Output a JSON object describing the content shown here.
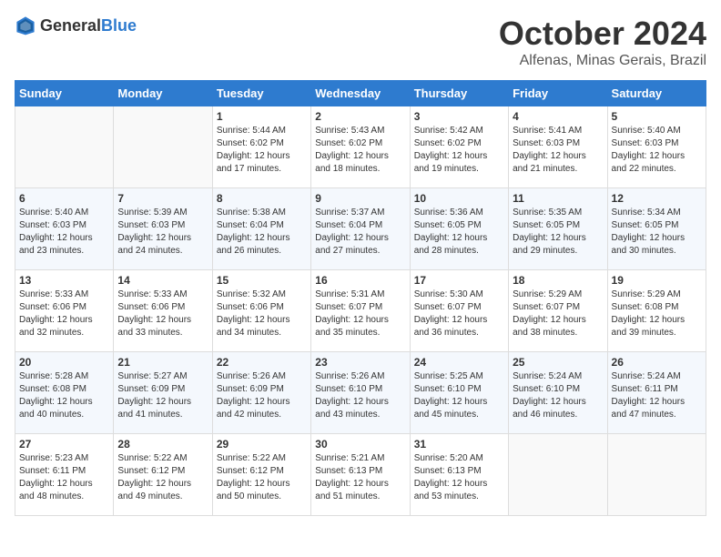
{
  "header": {
    "logo_general": "General",
    "logo_blue": "Blue",
    "month": "October 2024",
    "location": "Alfenas, Minas Gerais, Brazil"
  },
  "weekdays": [
    "Sunday",
    "Monday",
    "Tuesday",
    "Wednesday",
    "Thursday",
    "Friday",
    "Saturday"
  ],
  "weeks": [
    [
      {
        "day": "",
        "sunrise": "",
        "sunset": "",
        "daylight": ""
      },
      {
        "day": "",
        "sunrise": "",
        "sunset": "",
        "daylight": ""
      },
      {
        "day": "1",
        "sunrise": "Sunrise: 5:44 AM",
        "sunset": "Sunset: 6:02 PM",
        "daylight": "Daylight: 12 hours and 17 minutes."
      },
      {
        "day": "2",
        "sunrise": "Sunrise: 5:43 AM",
        "sunset": "Sunset: 6:02 PM",
        "daylight": "Daylight: 12 hours and 18 minutes."
      },
      {
        "day": "3",
        "sunrise": "Sunrise: 5:42 AM",
        "sunset": "Sunset: 6:02 PM",
        "daylight": "Daylight: 12 hours and 19 minutes."
      },
      {
        "day": "4",
        "sunrise": "Sunrise: 5:41 AM",
        "sunset": "Sunset: 6:03 PM",
        "daylight": "Daylight: 12 hours and 21 minutes."
      },
      {
        "day": "5",
        "sunrise": "Sunrise: 5:40 AM",
        "sunset": "Sunset: 6:03 PM",
        "daylight": "Daylight: 12 hours and 22 minutes."
      }
    ],
    [
      {
        "day": "6",
        "sunrise": "Sunrise: 5:40 AM",
        "sunset": "Sunset: 6:03 PM",
        "daylight": "Daylight: 12 hours and 23 minutes."
      },
      {
        "day": "7",
        "sunrise": "Sunrise: 5:39 AM",
        "sunset": "Sunset: 6:03 PM",
        "daylight": "Daylight: 12 hours and 24 minutes."
      },
      {
        "day": "8",
        "sunrise": "Sunrise: 5:38 AM",
        "sunset": "Sunset: 6:04 PM",
        "daylight": "Daylight: 12 hours and 26 minutes."
      },
      {
        "day": "9",
        "sunrise": "Sunrise: 5:37 AM",
        "sunset": "Sunset: 6:04 PM",
        "daylight": "Daylight: 12 hours and 27 minutes."
      },
      {
        "day": "10",
        "sunrise": "Sunrise: 5:36 AM",
        "sunset": "Sunset: 6:05 PM",
        "daylight": "Daylight: 12 hours and 28 minutes."
      },
      {
        "day": "11",
        "sunrise": "Sunrise: 5:35 AM",
        "sunset": "Sunset: 6:05 PM",
        "daylight": "Daylight: 12 hours and 29 minutes."
      },
      {
        "day": "12",
        "sunrise": "Sunrise: 5:34 AM",
        "sunset": "Sunset: 6:05 PM",
        "daylight": "Daylight: 12 hours and 30 minutes."
      }
    ],
    [
      {
        "day": "13",
        "sunrise": "Sunrise: 5:33 AM",
        "sunset": "Sunset: 6:06 PM",
        "daylight": "Daylight: 12 hours and 32 minutes."
      },
      {
        "day": "14",
        "sunrise": "Sunrise: 5:33 AM",
        "sunset": "Sunset: 6:06 PM",
        "daylight": "Daylight: 12 hours and 33 minutes."
      },
      {
        "day": "15",
        "sunrise": "Sunrise: 5:32 AM",
        "sunset": "Sunset: 6:06 PM",
        "daylight": "Daylight: 12 hours and 34 minutes."
      },
      {
        "day": "16",
        "sunrise": "Sunrise: 5:31 AM",
        "sunset": "Sunset: 6:07 PM",
        "daylight": "Daylight: 12 hours and 35 minutes."
      },
      {
        "day": "17",
        "sunrise": "Sunrise: 5:30 AM",
        "sunset": "Sunset: 6:07 PM",
        "daylight": "Daylight: 12 hours and 36 minutes."
      },
      {
        "day": "18",
        "sunrise": "Sunrise: 5:29 AM",
        "sunset": "Sunset: 6:07 PM",
        "daylight": "Daylight: 12 hours and 38 minutes."
      },
      {
        "day": "19",
        "sunrise": "Sunrise: 5:29 AM",
        "sunset": "Sunset: 6:08 PM",
        "daylight": "Daylight: 12 hours and 39 minutes."
      }
    ],
    [
      {
        "day": "20",
        "sunrise": "Sunrise: 5:28 AM",
        "sunset": "Sunset: 6:08 PM",
        "daylight": "Daylight: 12 hours and 40 minutes."
      },
      {
        "day": "21",
        "sunrise": "Sunrise: 5:27 AM",
        "sunset": "Sunset: 6:09 PM",
        "daylight": "Daylight: 12 hours and 41 minutes."
      },
      {
        "day": "22",
        "sunrise": "Sunrise: 5:26 AM",
        "sunset": "Sunset: 6:09 PM",
        "daylight": "Daylight: 12 hours and 42 minutes."
      },
      {
        "day": "23",
        "sunrise": "Sunrise: 5:26 AM",
        "sunset": "Sunset: 6:10 PM",
        "daylight": "Daylight: 12 hours and 43 minutes."
      },
      {
        "day": "24",
        "sunrise": "Sunrise: 5:25 AM",
        "sunset": "Sunset: 6:10 PM",
        "daylight": "Daylight: 12 hours and 45 minutes."
      },
      {
        "day": "25",
        "sunrise": "Sunrise: 5:24 AM",
        "sunset": "Sunset: 6:10 PM",
        "daylight": "Daylight: 12 hours and 46 minutes."
      },
      {
        "day": "26",
        "sunrise": "Sunrise: 5:24 AM",
        "sunset": "Sunset: 6:11 PM",
        "daylight": "Daylight: 12 hours and 47 minutes."
      }
    ],
    [
      {
        "day": "27",
        "sunrise": "Sunrise: 5:23 AM",
        "sunset": "Sunset: 6:11 PM",
        "daylight": "Daylight: 12 hours and 48 minutes."
      },
      {
        "day": "28",
        "sunrise": "Sunrise: 5:22 AM",
        "sunset": "Sunset: 6:12 PM",
        "daylight": "Daylight: 12 hours and 49 minutes."
      },
      {
        "day": "29",
        "sunrise": "Sunrise: 5:22 AM",
        "sunset": "Sunset: 6:12 PM",
        "daylight": "Daylight: 12 hours and 50 minutes."
      },
      {
        "day": "30",
        "sunrise": "Sunrise: 5:21 AM",
        "sunset": "Sunset: 6:13 PM",
        "daylight": "Daylight: 12 hours and 51 minutes."
      },
      {
        "day": "31",
        "sunrise": "Sunrise: 5:20 AM",
        "sunset": "Sunset: 6:13 PM",
        "daylight": "Daylight: 12 hours and 53 minutes."
      },
      {
        "day": "",
        "sunrise": "",
        "sunset": "",
        "daylight": ""
      },
      {
        "day": "",
        "sunrise": "",
        "sunset": "",
        "daylight": ""
      }
    ]
  ]
}
